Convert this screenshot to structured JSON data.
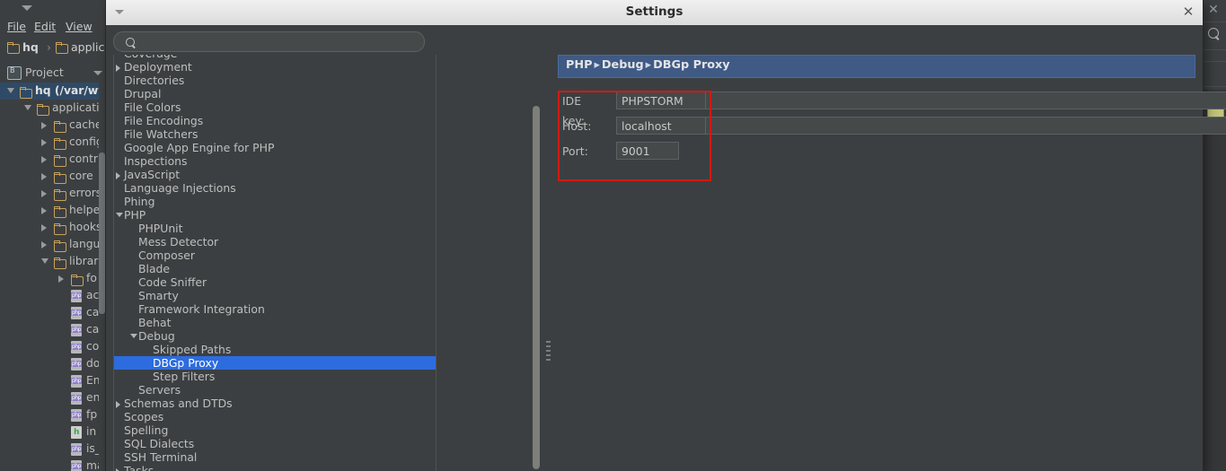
{
  "ide": {
    "menu": [
      {
        "name": "file",
        "label": "File",
        "accel": "F"
      },
      {
        "name": "edit",
        "label": "Edit",
        "accel": "E"
      },
      {
        "name": "view",
        "label": "View",
        "accel": "V"
      }
    ],
    "breadcrumb": {
      "root": "hq",
      "separator": "›",
      "child": "applic"
    },
    "project_tool": {
      "label": "Project",
      "icon": "project-icon",
      "caret": "chevron-down-icon"
    },
    "file_tree": [
      {
        "label": "hq (/var/ww",
        "depth": 0,
        "twisty": "open",
        "icon": "folder",
        "bold": true,
        "selected": true
      },
      {
        "label": "applicati",
        "depth": 1,
        "twisty": "open",
        "icon": "folder",
        "bold": false,
        "selected": false
      },
      {
        "label": "cache",
        "depth": 2,
        "twisty": "closed",
        "icon": "folder",
        "bold": false,
        "selected": false
      },
      {
        "label": "config",
        "depth": 2,
        "twisty": "closed",
        "icon": "folder",
        "bold": false,
        "selected": false
      },
      {
        "label": "contr",
        "depth": 2,
        "twisty": "closed",
        "icon": "folder",
        "bold": false,
        "selected": false
      },
      {
        "label": "core",
        "depth": 2,
        "twisty": "closed",
        "icon": "folder",
        "bold": false,
        "selected": false
      },
      {
        "label": "errors",
        "depth": 2,
        "twisty": "closed",
        "icon": "folder",
        "bold": false,
        "selected": false
      },
      {
        "label": "helpe",
        "depth": 2,
        "twisty": "closed",
        "icon": "folder",
        "bold": false,
        "selected": false
      },
      {
        "label": "hooks",
        "depth": 2,
        "twisty": "closed",
        "icon": "folder",
        "bold": false,
        "selected": false
      },
      {
        "label": "langu",
        "depth": 2,
        "twisty": "closed",
        "icon": "folder",
        "bold": false,
        "selected": false
      },
      {
        "label": "librari",
        "depth": 2,
        "twisty": "open",
        "icon": "folder",
        "bold": false,
        "selected": false
      },
      {
        "label": "fo",
        "depth": 3,
        "twisty": "closed",
        "icon": "folder",
        "bold": false,
        "selected": false
      },
      {
        "label": "ac",
        "depth": 3,
        "twisty": "none",
        "icon": "php",
        "bold": false,
        "selected": false
      },
      {
        "label": "ca",
        "depth": 3,
        "twisty": "none",
        "icon": "php",
        "bold": false,
        "selected": false
      },
      {
        "label": "ca",
        "depth": 3,
        "twisty": "none",
        "icon": "php",
        "bold": false,
        "selected": false
      },
      {
        "label": "co",
        "depth": 3,
        "twisty": "none",
        "icon": "php",
        "bold": false,
        "selected": false
      },
      {
        "label": "do",
        "depth": 3,
        "twisty": "none",
        "icon": "php",
        "bold": false,
        "selected": false
      },
      {
        "label": "En",
        "depth": 3,
        "twisty": "none",
        "icon": "php",
        "bold": false,
        "selected": false
      },
      {
        "label": "en",
        "depth": 3,
        "twisty": "none",
        "icon": "php",
        "bold": false,
        "selected": false
      },
      {
        "label": "fp",
        "depth": 3,
        "twisty": "none",
        "icon": "php",
        "bold": false,
        "selected": false
      },
      {
        "label": "in",
        "depth": 3,
        "twisty": "none",
        "icon": "html",
        "bold": false,
        "selected": false
      },
      {
        "label": "is_",
        "depth": 3,
        "twisty": "none",
        "icon": "php",
        "bold": false,
        "selected": false
      },
      {
        "label": "ma",
        "depth": 3,
        "twisty": "none",
        "icon": "php",
        "bold": false,
        "selected": false
      }
    ],
    "editor_gutter": {
      "close_icon": "close-icon",
      "search_icon": "search-icon",
      "marker_color": "#9a9600",
      "thumb_color": "#c2c47a"
    }
  },
  "dialog": {
    "title": "Settings",
    "close_icon": "close-icon",
    "menu_caret_icon": "chevron-down-icon",
    "search": {
      "placeholder": "",
      "value": "",
      "icon": "search-icon"
    },
    "tree": [
      {
        "label": "Coverage",
        "depth": 1,
        "twisty": "none",
        "selected": false,
        "clipped": true
      },
      {
        "label": "Deployment",
        "depth": 1,
        "twisty": "closed",
        "selected": false
      },
      {
        "label": "Directories",
        "depth": 1,
        "twisty": "none",
        "selected": false
      },
      {
        "label": "Drupal",
        "depth": 1,
        "twisty": "none",
        "selected": false
      },
      {
        "label": "File Colors",
        "depth": 1,
        "twisty": "none",
        "selected": false
      },
      {
        "label": "File Encodings",
        "depth": 1,
        "twisty": "none",
        "selected": false
      },
      {
        "label": "File Watchers",
        "depth": 1,
        "twisty": "none",
        "selected": false
      },
      {
        "label": "Google App Engine for PHP",
        "depth": 1,
        "twisty": "none",
        "selected": false
      },
      {
        "label": "Inspections",
        "depth": 1,
        "twisty": "none",
        "selected": false
      },
      {
        "label": "JavaScript",
        "depth": 1,
        "twisty": "closed",
        "selected": false
      },
      {
        "label": "Language Injections",
        "depth": 1,
        "twisty": "none",
        "selected": false
      },
      {
        "label": "Phing",
        "depth": 1,
        "twisty": "none",
        "selected": false
      },
      {
        "label": "PHP",
        "depth": 1,
        "twisty": "open",
        "selected": false
      },
      {
        "label": "PHPUnit",
        "depth": 2,
        "twisty": "none",
        "selected": false
      },
      {
        "label": "Mess Detector",
        "depth": 2,
        "twisty": "none",
        "selected": false
      },
      {
        "label": "Composer",
        "depth": 2,
        "twisty": "none",
        "selected": false
      },
      {
        "label": "Blade",
        "depth": 2,
        "twisty": "none",
        "selected": false
      },
      {
        "label": "Code Sniffer",
        "depth": 2,
        "twisty": "none",
        "selected": false
      },
      {
        "label": "Smarty",
        "depth": 2,
        "twisty": "none",
        "selected": false
      },
      {
        "label": "Framework Integration",
        "depth": 2,
        "twisty": "none",
        "selected": false
      },
      {
        "label": "Behat",
        "depth": 2,
        "twisty": "none",
        "selected": false
      },
      {
        "label": "Debug",
        "depth": 2,
        "twisty": "open",
        "selected": false
      },
      {
        "label": "Skipped Paths",
        "depth": 3,
        "twisty": "none",
        "selected": false
      },
      {
        "label": "DBGp Proxy",
        "depth": 3,
        "twisty": "none",
        "selected": true
      },
      {
        "label": "Step Filters",
        "depth": 3,
        "twisty": "none",
        "selected": false
      },
      {
        "label": "Servers",
        "depth": 2,
        "twisty": "none",
        "selected": false
      },
      {
        "label": "Schemas and DTDs",
        "depth": 1,
        "twisty": "closed",
        "selected": false
      },
      {
        "label": "Scopes",
        "depth": 1,
        "twisty": "none",
        "selected": false
      },
      {
        "label": "Spelling",
        "depth": 1,
        "twisty": "none",
        "selected": false
      },
      {
        "label": "SQL Dialects",
        "depth": 1,
        "twisty": "none",
        "selected": false
      },
      {
        "label": "SSH Terminal",
        "depth": 1,
        "twisty": "none",
        "selected": false
      },
      {
        "label": "Tasks",
        "depth": 1,
        "twisty": "closed",
        "selected": false,
        "clipped": true
      }
    ],
    "breadcrumb": {
      "parts": [
        "PHP",
        "Debug",
        "DBGp Proxy"
      ],
      "separator": "▸",
      "full": "PHP ▸ Debug ▸ DBGp Proxy"
    },
    "form": {
      "ide_key": {
        "label": "IDE key:",
        "value": "PHPSTORM"
      },
      "host": {
        "label": "Host:",
        "value": "localhost"
      },
      "port": {
        "label": "Port:",
        "value": "9001"
      }
    },
    "highlight_color": "#d11a12"
  }
}
